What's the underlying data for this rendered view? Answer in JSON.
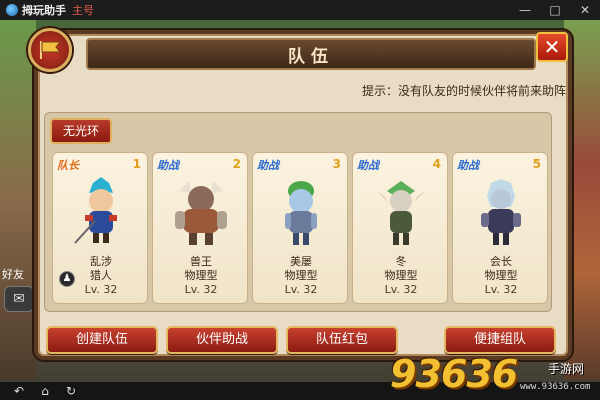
{
  "app": {
    "name": "拇玩助手",
    "subtitle": "主号",
    "window_controls": [
      "—",
      "□",
      "✕"
    ]
  },
  "game_bg": {
    "chat_icon": "speech-bubble-icon",
    "left_label": "好友"
  },
  "dialog": {
    "title": "队伍",
    "hint": "提示：没有队友的时候伙伴将前来助阵",
    "close_label": "✕",
    "team_name_label": "无光环"
  },
  "members": [
    {
      "role": "队长",
      "slot": "1",
      "name": "乱涉",
      "class": "猎人",
      "level": "Lv. 32"
    },
    {
      "role": "助战",
      "slot": "2",
      "name": "兽王",
      "class": "物理型",
      "level": "Lv. 32"
    },
    {
      "role": "助战",
      "slot": "3",
      "name": "美屡",
      "class": "物理型",
      "level": "Lv. 32"
    },
    {
      "role": "助战",
      "slot": "4",
      "name": "冬",
      "class": "物理型",
      "level": "Lv. 32"
    },
    {
      "role": "助战",
      "slot": "5",
      "name": "会长",
      "class": "物理型",
      "level": "Lv. 32"
    }
  ],
  "actions": {
    "create_team": "创建队伍",
    "partner_assist": "伙伴助战",
    "team_red_packet": "队伍红包",
    "quick_team": "便捷组队"
  },
  "navbar": {
    "icons": [
      "back-icon",
      "home-icon",
      "refresh-icon"
    ]
  },
  "watermark": {
    "number": "93636",
    "label": "手游网",
    "url": "www.93636.com"
  },
  "colors": {
    "panel_bg": "#e8dcc4",
    "button_red": "#b83a2a",
    "leader_role": "#e06a1a",
    "assist_role": "#2a6ad0",
    "slot_number": "#e0a01a"
  }
}
